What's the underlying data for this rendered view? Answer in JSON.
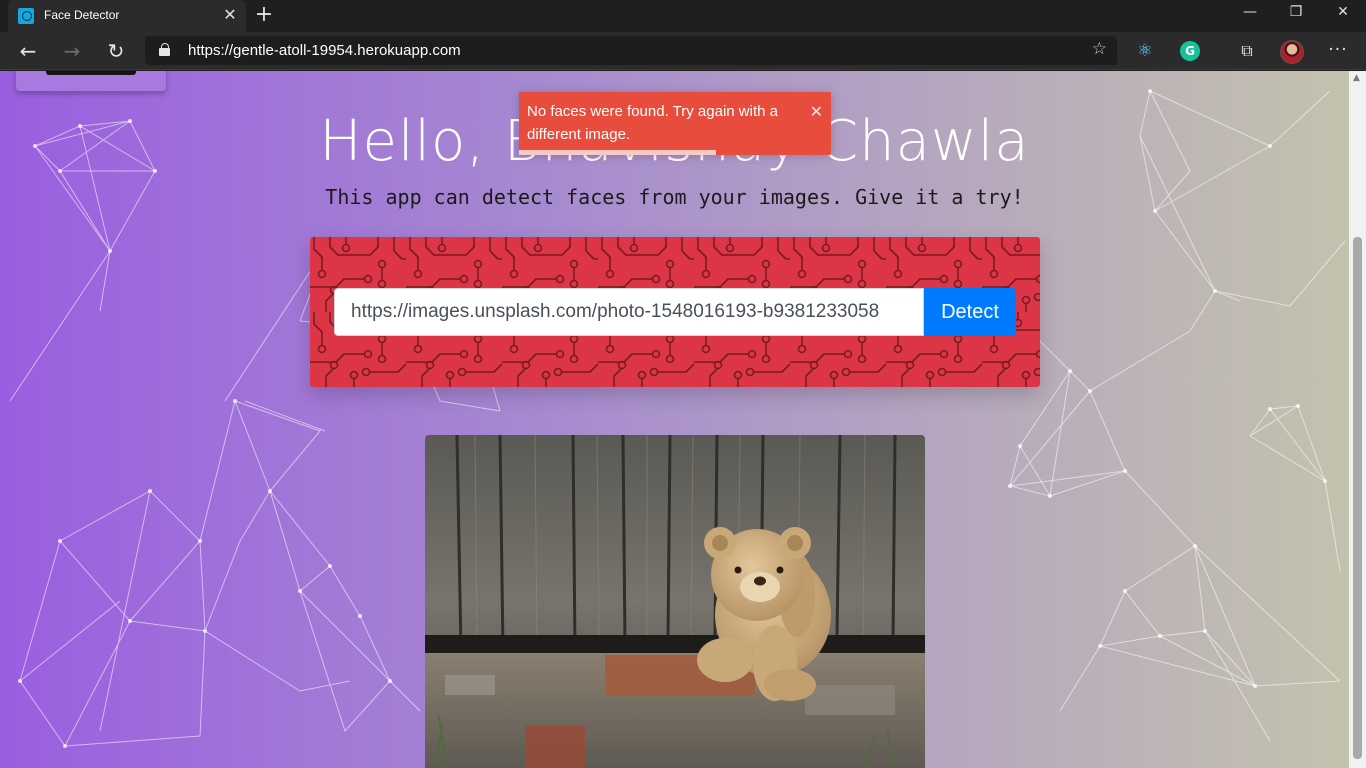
{
  "browser": {
    "tab_title": "Face Detector",
    "tab_close": "✕",
    "new_tab": "+",
    "window_controls": {
      "minimize": "—",
      "restore": "❐",
      "close": "✕"
    },
    "nav": {
      "back": "←",
      "forward": "→",
      "refresh": "↻"
    },
    "address_url": "https://gentle-atoll-19954.herokuapp.com",
    "favorite": "☆",
    "extensions": {
      "react": "⚛",
      "grammarly": "G",
      "collections": "⧉"
    },
    "menu": "···"
  },
  "page": {
    "greeting": "Hello, Bhavishay Chawla",
    "subtitle": "This app can detect faces from your images. Give it a try!",
    "image_url_value": "https://images.unsplash.com/photo-1548016193-b9381233058",
    "detect_label": "Detect"
  },
  "toast": {
    "message": "No faces were found. Try again with a different image.",
    "close": "✕",
    "progress": 0.63
  },
  "colors": {
    "card": "#dc3545",
    "button": "#007bff",
    "toast": "#e74c3c",
    "gradient_left": "#9a5ee0",
    "gradient_right": "#c3c2ad"
  },
  "icons": [
    "face-detector-favicon",
    "back-arrow-icon",
    "forward-arrow-icon",
    "refresh-icon",
    "lock-icon",
    "star-icon",
    "react-devtools-icon",
    "grammarly-icon",
    "collections-icon",
    "profile-avatar",
    "more-icon",
    "close-icon"
  ]
}
